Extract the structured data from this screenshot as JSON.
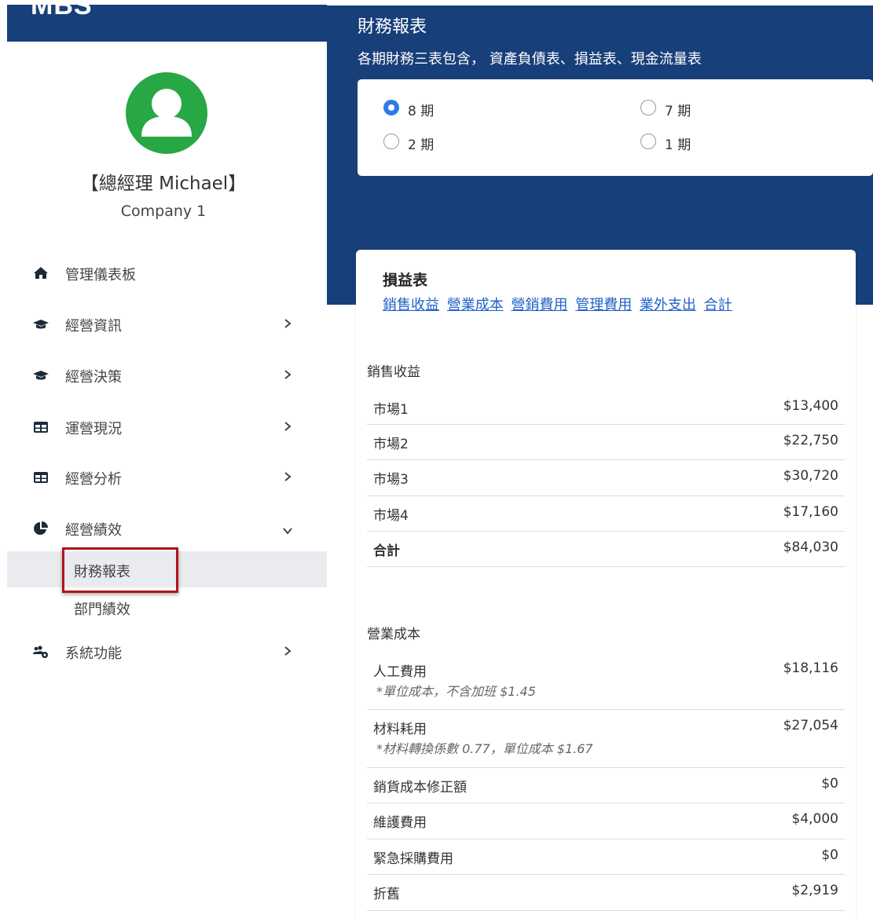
{
  "brand": {
    "name": "MBS"
  },
  "user": {
    "name": "【總經理 Michael】",
    "company": "Company 1"
  },
  "sidebar": {
    "items": [
      {
        "label": "管理儀表板",
        "icon": "home-icon"
      },
      {
        "label": "經營資訊",
        "icon": "graduation-cap-icon"
      },
      {
        "label": "經營決策",
        "icon": "graduation-cap-icon"
      },
      {
        "label": "運營現況",
        "icon": "table-icon"
      },
      {
        "label": "經營分析",
        "icon": "table-icon"
      },
      {
        "label": "經營績效",
        "icon": "pie-chart-icon"
      },
      {
        "label": "系統功能",
        "icon": "users-cog-icon"
      }
    ],
    "subitems": [
      {
        "label": "財務報表",
        "active": true
      },
      {
        "label": "部門績效",
        "active": false
      }
    ]
  },
  "header": {
    "title": "財務報表",
    "subtitle": "各期財務三表包含， 資產負債表、損益表、現金流量表"
  },
  "periods": [
    {
      "label": "8 期",
      "checked": true
    },
    {
      "label": "7 期",
      "checked": false
    },
    {
      "label": "2 期",
      "checked": false
    },
    {
      "label": "1 期",
      "checked": false
    }
  ],
  "income_statement": {
    "title": "損益表",
    "anchors": [
      "銷售收益",
      "營業成本",
      "營銷費用",
      "管理費用",
      "業外支出",
      "合計"
    ],
    "sales": {
      "title": "銷售收益",
      "rows": [
        {
          "name": "市場1",
          "value": "$13,400"
        },
        {
          "name": "市場2",
          "value": "$22,750"
        },
        {
          "name": "市場3",
          "value": "$30,720"
        },
        {
          "name": "市場4",
          "value": "$17,160"
        },
        {
          "name": "合計",
          "value": "$84,030"
        }
      ]
    },
    "cost": {
      "title": "營業成本",
      "rows": [
        {
          "name": "人工費用",
          "value": "$18,116",
          "note": "*單位成本，不含加班 $1.45"
        },
        {
          "name": "材料耗用",
          "value": "$27,054",
          "note": "*材料轉換係數 0.77，單位成本 $1.67"
        },
        {
          "name": "銷貨成本修正額",
          "value": "$0"
        },
        {
          "name": "維護費用",
          "value": "$4,000"
        },
        {
          "name": "緊急採購費用",
          "value": "$0"
        },
        {
          "name": "折舊",
          "value": "$2,919"
        }
      ]
    }
  },
  "colors": {
    "header": "#173f7a",
    "avatar": "#28a745",
    "link": "#1f62c8",
    "highlight": "#b0141c"
  }
}
